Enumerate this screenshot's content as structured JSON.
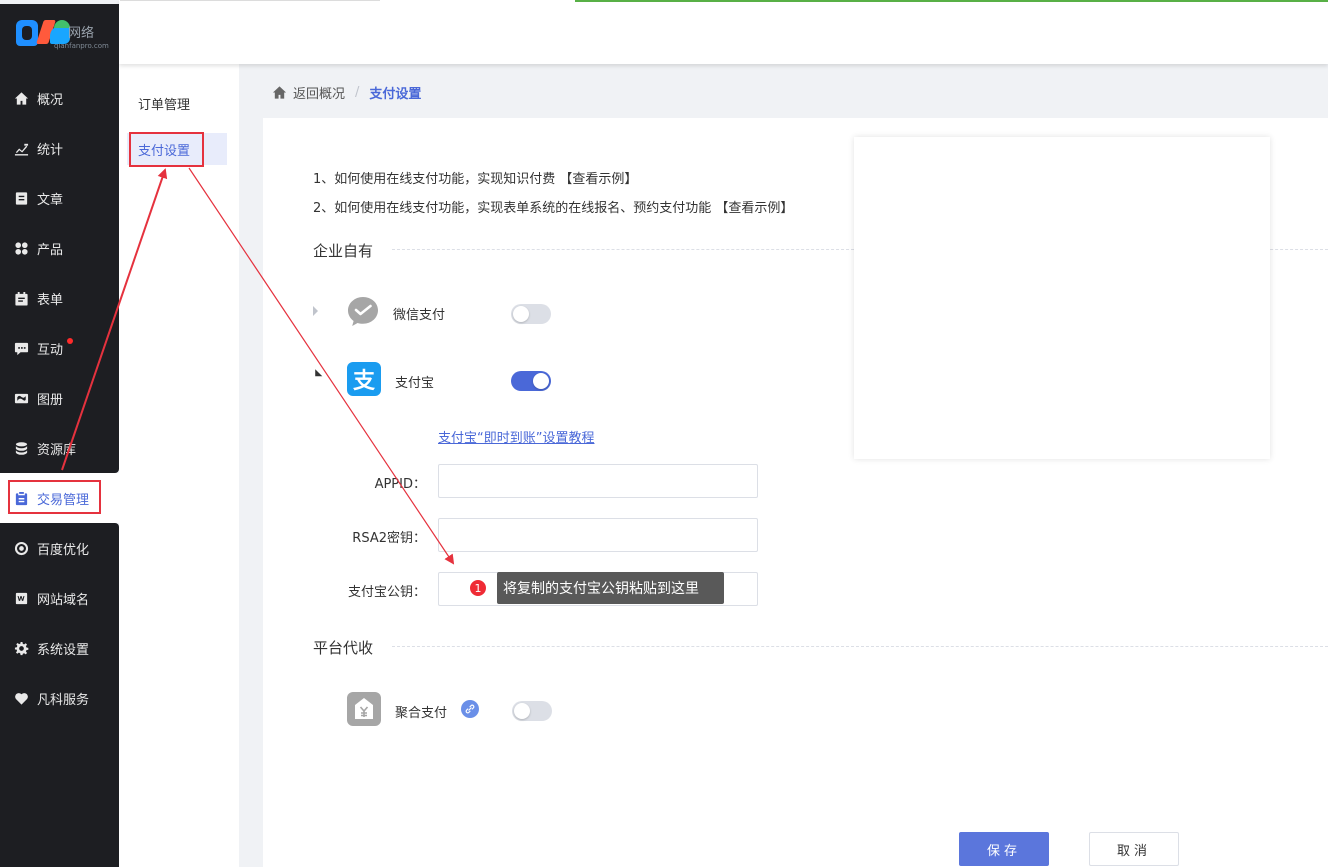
{
  "brand": {
    "logo_text": "网络",
    "logo_sub": "qianfanpro.com"
  },
  "sidebar": {
    "items": [
      {
        "label": "概况",
        "icon": "home-icon"
      },
      {
        "label": "统计",
        "icon": "chart-icon"
      },
      {
        "label": "文章",
        "icon": "article-icon"
      },
      {
        "label": "产品",
        "icon": "grid-icon"
      },
      {
        "label": "表单",
        "icon": "form-icon"
      },
      {
        "label": "互动",
        "icon": "chat-icon"
      },
      {
        "label": "图册",
        "icon": "album-icon"
      },
      {
        "label": "资源库",
        "icon": "database-icon"
      },
      {
        "label": "交易管理",
        "icon": "clipboard-icon"
      },
      {
        "label": "百度优化",
        "icon": "seo-icon"
      },
      {
        "label": "网站域名",
        "icon": "domain-icon"
      },
      {
        "label": "系统设置",
        "icon": "gear-icon"
      },
      {
        "label": "凡科服务",
        "icon": "heart-icon"
      }
    ],
    "active_index": 8
  },
  "submenu": {
    "items": [
      {
        "label": "订单管理"
      },
      {
        "label": "支付设置"
      }
    ],
    "active_index": 1
  },
  "breadcrumb": {
    "back": "返回概况",
    "separator": "/",
    "current": "支付设置"
  },
  "tips": {
    "line1": "1、如何使用在线支付功能，实现知识付费",
    "line1_link": "【查看示例】",
    "line2": "2、如何使用在线支付功能，实现表单系统的在线报名、预约支付功能",
    "line2_link": "【查看示例】"
  },
  "section_own": {
    "title": "企业自有",
    "wechat": {
      "label": "微信支付",
      "enabled": false
    },
    "alipay": {
      "label": "支付宝",
      "enabled": true,
      "icon_char": "支",
      "tutorial_link": "支付宝“即时到账”设置教程",
      "fields": [
        {
          "label": "APPID：",
          "value": ""
        },
        {
          "label": "RSA2密钥：",
          "value": ""
        },
        {
          "label": "支付宝公钥：",
          "value": ""
        }
      ]
    }
  },
  "section_platform": {
    "title": "平台代收",
    "aggregate": {
      "label": "聚合支付",
      "enabled": false
    }
  },
  "tooltip": {
    "number": "1",
    "text": "将复制的支付宝公钥粘贴到这里"
  },
  "buttons": {
    "save": "保存",
    "cancel": "取消"
  },
  "colors": {
    "accent": "#4a68d8",
    "sidebar_bg": "#1d1e22",
    "annotation_red": "#e5323e"
  }
}
